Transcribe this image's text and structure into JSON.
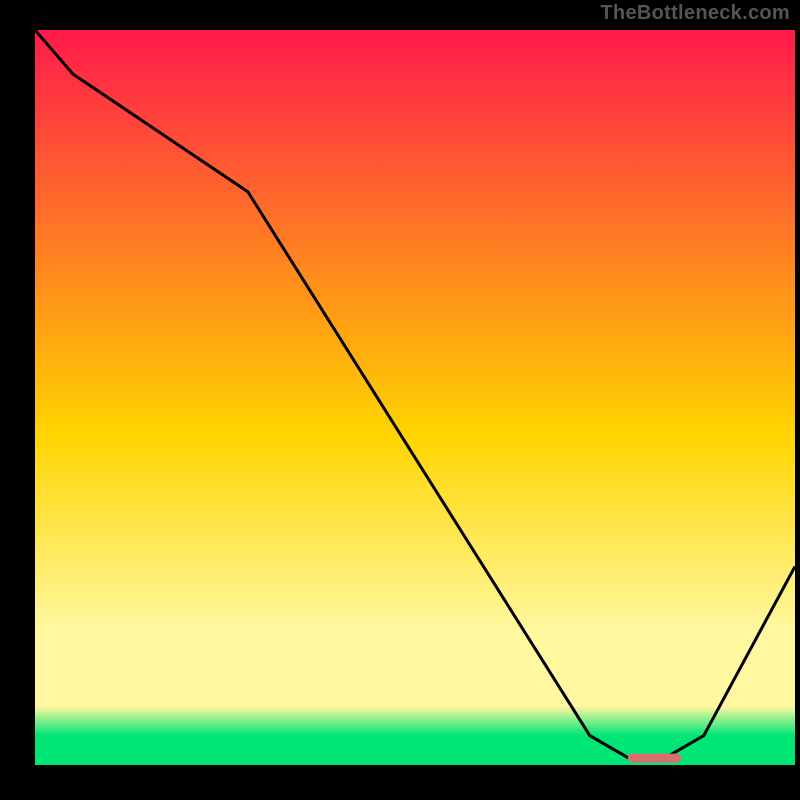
{
  "watermark": "TheBottleneck.com",
  "colors": {
    "top": "#ff1a4b",
    "mid": "#ffd400",
    "band": "#fff8a0",
    "green": "#00e676",
    "curve": "#000000",
    "marker": "#d9706f"
  },
  "chart_data": {
    "type": "line",
    "title": "",
    "xlabel": "",
    "ylabel": "",
    "xlim": [
      0,
      100
    ],
    "ylim": [
      0,
      100
    ],
    "series": [
      {
        "name": "curve",
        "x": [
          0,
          5,
          28,
          73,
          78,
          83,
          88,
          100
        ],
        "values": [
          100,
          94,
          78,
          4,
          1,
          1,
          4,
          27
        ]
      }
    ],
    "marker": {
      "x_start": 78,
      "x_end": 85,
      "y": 1
    },
    "gradient_stops_pct": [
      0,
      55,
      82,
      92,
      96,
      100
    ],
    "band_top_pct": 82,
    "green_top_pct": 96
  }
}
